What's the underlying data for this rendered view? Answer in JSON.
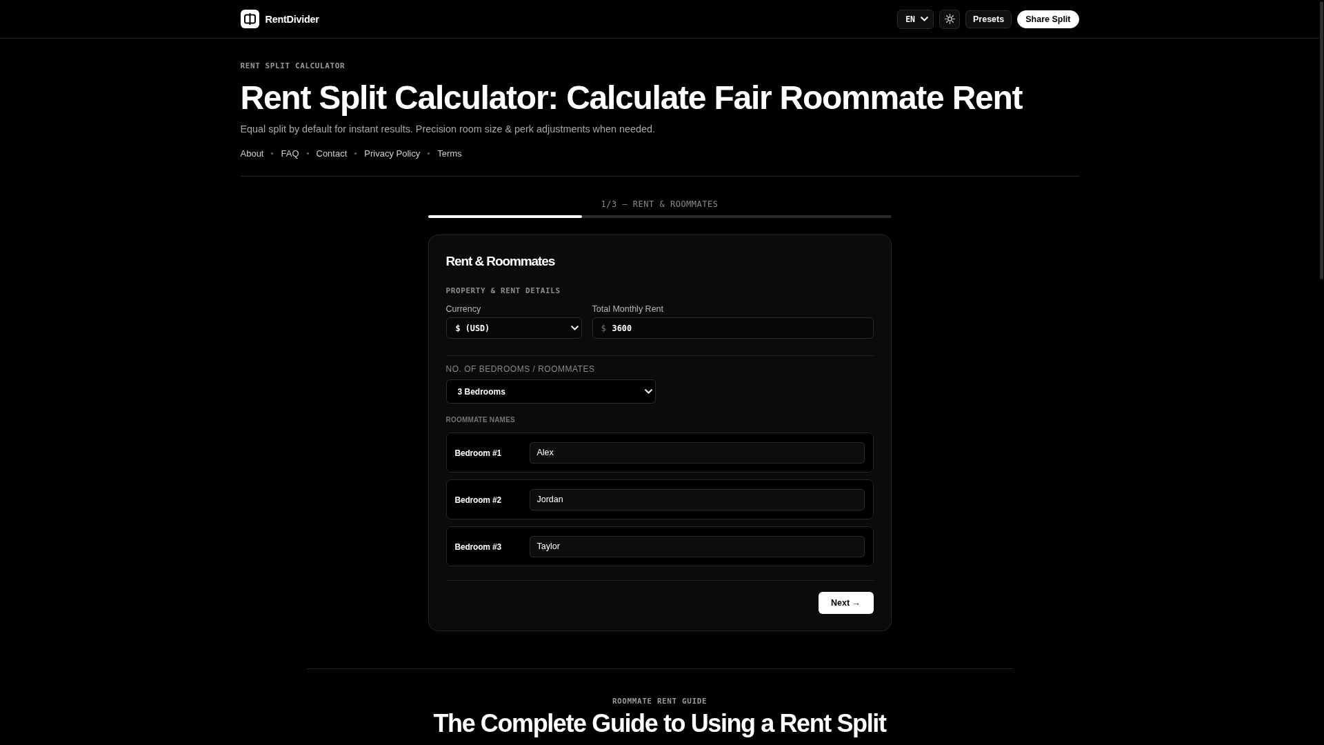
{
  "header": {
    "brand": "RentDivider",
    "language": "EN",
    "buttons": [
      {
        "label": "Presets",
        "kind": "secondary"
      },
      {
        "label": "Share Split",
        "kind": "primary"
      }
    ]
  },
  "intro": {
    "eyebrow": "RENT SPLIT CALCULATOR",
    "title": "Rent Split Calculator: Calculate Fair Roommate Rent",
    "subtitle": "Equal split by default for instant results. Precision room size & perk adjustments when needed.",
    "links": [
      "About",
      "FAQ",
      "Contact",
      "Privacy Policy",
      "Terms"
    ]
  },
  "stepper": {
    "label": "1/3 — RENT & ROOMMATES",
    "level": 0.333
  },
  "card": {
    "title": "Rent & Roommates",
    "section_label": "PROPERTY & RENT DETAILS",
    "currency": {
      "label": "Currency",
      "value": "$ (USD)"
    },
    "rent": {
      "label": "Total Monthly Rent",
      "prefix": "$",
      "value": "3600"
    },
    "bedrooms": {
      "label": "NO. OF BEDROOMS / ROOMMATES",
      "value": "3 Bedrooms"
    },
    "names_label": "ROOMMATE NAMES",
    "roommates": [
      {
        "label": "Bedroom #1",
        "name": "Alex"
      },
      {
        "label": "Bedroom #2",
        "name": "Jordan"
      },
      {
        "label": "Bedroom #3",
        "name": "Taylor"
      }
    ],
    "next_button": "Next →"
  },
  "guide": {
    "eyebrow": "ROOMMATE RENT GUIDE",
    "title": "The Complete Guide to Using a Rent Split"
  }
}
